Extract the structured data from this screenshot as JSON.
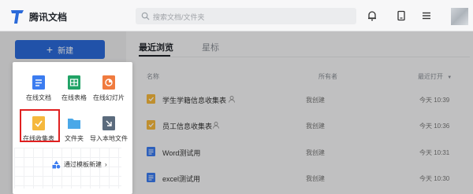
{
  "app": {
    "name": "腾讯文档"
  },
  "search": {
    "placeholder": "搜索文档/文件夹"
  },
  "sidebar": {
    "new_button_label": "新建"
  },
  "create_menu": {
    "items": [
      {
        "label": "在线文档",
        "icon": "doc-icon",
        "color": "#3b7cf0"
      },
      {
        "label": "在线表格",
        "icon": "sheet-icon",
        "color": "#21a366"
      },
      {
        "label": "在线幻灯片",
        "icon": "slide-icon",
        "color": "#f07b3f"
      },
      {
        "label": "在线收集表",
        "icon": "form-icon",
        "color": "#f5b83d"
      },
      {
        "label": "文件夹",
        "icon": "folder-icon",
        "color": "#4aa8e8"
      },
      {
        "label": "导入本地文件",
        "icon": "import-icon",
        "color": "#5b6b7d"
      }
    ],
    "template_link": "通过模板新建"
  },
  "main": {
    "tabs": [
      {
        "label": "最近浏览",
        "active": true
      },
      {
        "label": "星标",
        "active": false
      }
    ],
    "columns": {
      "name": "名称",
      "owner": "所有者",
      "last_opened": "最近打开"
    },
    "files": [
      {
        "name": "学生学籍信息收集表",
        "type": "form",
        "color": "#f5b83d",
        "owner": "我创建",
        "time": "今天 10:39",
        "shared": true
      },
      {
        "name": "员工信息收集表",
        "type": "form",
        "color": "#f5b83d",
        "owner": "我创建",
        "time": "今天 10:36",
        "shared": true
      },
      {
        "name": "Word测试用",
        "type": "doc",
        "color": "#3b7cf0",
        "owner": "我创建",
        "time": "今天 10:31",
        "shared": false
      },
      {
        "name": "excel测试用",
        "type": "doc",
        "color": "#3b7cf0",
        "owner": "我创建",
        "time": "今天 10:30",
        "shared": false
      }
    ]
  },
  "colors": {
    "accent": "#2b6ad9",
    "highlight": "#e02020"
  }
}
